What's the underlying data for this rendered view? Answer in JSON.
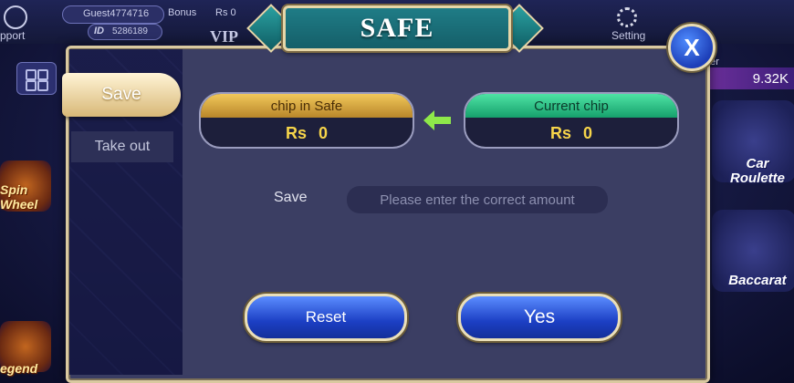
{
  "background": {
    "player_id_label": "Guest4774716",
    "bonus_label": "Bonus",
    "bonus_value": "Rs  0",
    "id_prefix": "ID",
    "id_value": "5286189",
    "support_label": "pport",
    "settings_label": "Setting",
    "vip_label": "VIP",
    "ranking_label": "ger",
    "balance_value": "9.32K",
    "left_games": [
      "Spin Wheel",
      "egend"
    ],
    "right_games": [
      "Car Roulette",
      "Baccarat"
    ]
  },
  "dialog": {
    "title": "SAFE",
    "close_label": "X"
  },
  "tabs": [
    {
      "label": "Save",
      "active": true
    },
    {
      "label": "Take out",
      "active": false
    }
  ],
  "chips": {
    "safe": {
      "caption": "chip in Safe",
      "value": "Rs 0"
    },
    "current": {
      "caption": "Current chip",
      "value": "Rs 0"
    }
  },
  "form": {
    "label": "Save",
    "placeholder": "Please enter the correct amount"
  },
  "buttons": {
    "reset": "Reset",
    "yes": "Yes"
  },
  "colors": {
    "gold": "#f1c85a",
    "green": "#4ee3a4",
    "value_text": "#f7d54a",
    "button_blue": "#1c3fc4",
    "header_teal": "#1f7c86"
  }
}
